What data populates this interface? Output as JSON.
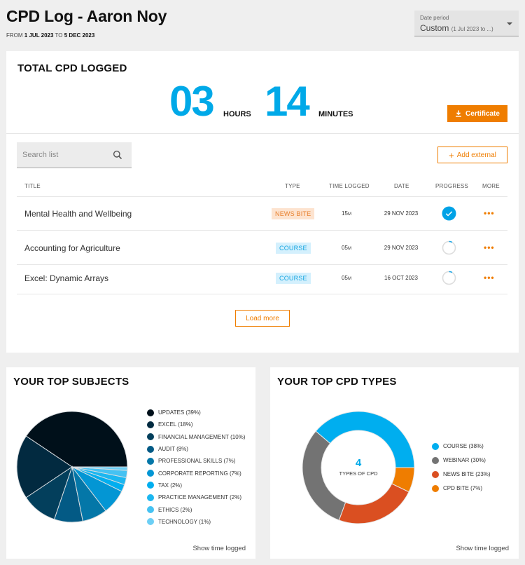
{
  "header": {
    "title": "CPD Log - Aaron Noy",
    "range_from_label": "FROM",
    "range_from": "1 JUL 2023",
    "range_to_label": "TO",
    "range_to": "5 DEC 2023"
  },
  "date_period": {
    "label": "Date period",
    "value": "Custom",
    "value_detail": "(1 Jul 2023 to ...)"
  },
  "total": {
    "title": "TOTAL CPD LOGGED",
    "hours": "03",
    "hours_label": "HOURS",
    "minutes": "14",
    "minutes_label": "MINUTES",
    "certificate_label": "Certificate"
  },
  "search": {
    "placeholder": "Search list",
    "value": ""
  },
  "add_external_label": "Add external",
  "table": {
    "headers": {
      "title": "TITLE",
      "type": "TYPE",
      "time": "TIME LOGGED",
      "date": "DATE",
      "progress": "PROGRESS",
      "more": "MORE"
    },
    "rows": [
      {
        "title": "Mental Health and Wellbeing",
        "type": "NEWS BITE",
        "time_num": "15",
        "time_unit": "M",
        "date": "29 NOV 2023",
        "progress": "complete",
        "progress_value": 1.0
      },
      {
        "title": "Accounting for Agriculture",
        "type": "COURSE",
        "time_num": "05",
        "time_unit": "M",
        "date": "29 NOV 2023",
        "progress": "in-progress",
        "progress_value": 0.08
      },
      {
        "title": "Excel: Dynamic Arrays",
        "type": "COURSE",
        "time_num": "05",
        "time_unit": "M",
        "date": "16 OCT 2023",
        "progress": "in-progress",
        "progress_value": 0.08
      }
    ],
    "more_glyph": "•••"
  },
  "load_more_label": "Load more",
  "colors": {
    "accent_orange": "#ef7d00",
    "accent_blue": "#00a9e8"
  },
  "subjects_card": {
    "title": "YOUR TOP SUBJECTS",
    "show_time_label": "Show time logged"
  },
  "types_card": {
    "title": "YOUR TOP CPD TYPES",
    "center_number": "4",
    "center_label": "TYPES OF CPD",
    "show_time_label": "Show time logged"
  },
  "chart_data": [
    {
      "type": "pie",
      "title": "YOUR TOP SUBJECTS",
      "legend_position": "right",
      "direction": "counter-clockwise from 3 o'clock",
      "categories": [
        "UPDATES",
        "EXCEL",
        "FINANCIAL MANAGEMENT",
        "AUDIT",
        "PROFESSIONAL SKILLS",
        "CORPORATE REPORTING",
        "TAX",
        "PRACTICE MANAGEMENT",
        "ETHICS",
        "TECHNOLOGY"
      ],
      "values": [
        39,
        18,
        10,
        8,
        7,
        7,
        2,
        2,
        2,
        1
      ],
      "unit": "%",
      "colors": [
        "#00101a",
        "#022a40",
        "#033f5c",
        "#035a85",
        "#0477a8",
        "#0396d4",
        "#00aeef",
        "#1cb7f0",
        "#45c2f2",
        "#6ccff5"
      ]
    },
    {
      "type": "pie",
      "subtype": "donut",
      "title": "YOUR TOP CPD TYPES",
      "legend_position": "right",
      "direction": "counter-clockwise from 3 o'clock",
      "categories": [
        "COURSE",
        "WEBINAR",
        "NEWS BITE",
        "CPD BITE"
      ],
      "values": [
        38,
        30,
        23,
        7
      ],
      "unit": "%",
      "colors": [
        "#00aeef",
        "#737373",
        "#da4f21",
        "#ef7d00"
      ]
    }
  ]
}
